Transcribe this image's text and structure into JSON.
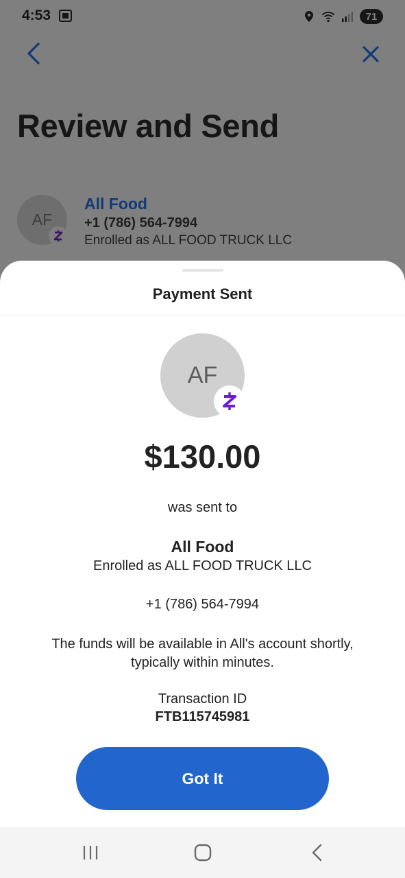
{
  "status_bar": {
    "time": "4:53",
    "battery": "71",
    "icons": [
      "app-notification-icon",
      "location-icon",
      "wifi-icon",
      "signal-icon",
      "battery-icon"
    ]
  },
  "background_screen": {
    "title": "Review and Send",
    "recipient": {
      "initials": "AF",
      "name": "All Food",
      "phone": "+1 (786) 564-7994",
      "enrolled": "Enrolled as ALL FOOD TRUCK LLC"
    }
  },
  "sheet": {
    "title": "Payment Sent",
    "avatar_initials": "AF",
    "badge_glyph": "Ƶ",
    "amount": "$130.00",
    "sent_to_text": "was sent to",
    "recipient_name": "All Food",
    "recipient_enrolled": "Enrolled as ALL FOOD TRUCK LLC",
    "recipient_phone": "+1 (786) 564-7994",
    "funds_message": "The funds will be available in All's account shortly, typically within minutes.",
    "transaction_label": "Transaction ID",
    "transaction_id": "FTB115745981",
    "button_label": "Got It"
  },
  "colors": {
    "accent_blue": "#2265cc",
    "zelle_purple": "#6d1ed4",
    "overlay_gray": "#7f7f7f",
    "link_blue_dimmed": "#123a78"
  }
}
